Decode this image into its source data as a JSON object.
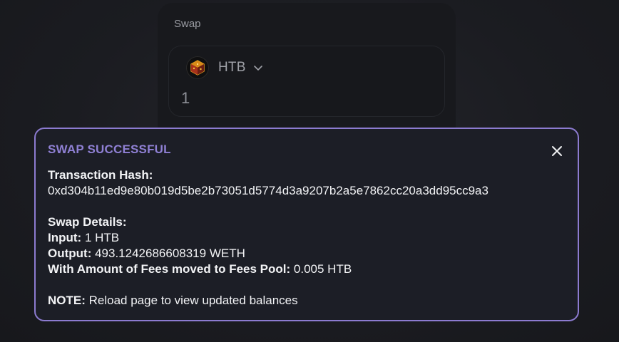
{
  "swap": {
    "title": "Swap",
    "token_symbol": "HTB",
    "amount": "1",
    "token_icon": "htb-cube-logo-icon",
    "chevron_icon": "chevron-down-icon"
  },
  "toast": {
    "title": "SWAP SUCCESSFUL",
    "close_icon": "close-icon",
    "tx_hash_label": "Transaction Hash:",
    "tx_hash_value": "0xd304b11ed9e80b019d5be2b73051d5774d3a9207b2a5e7862cc20a3dd95cc9a3",
    "details_label": "Swap Details:",
    "input_label": "Input:",
    "input_value": "1 HTB",
    "output_label": "Output:",
    "output_value": "493.1242686608319 WETH",
    "fees_label": "With Amount of Fees moved to Fees Pool:",
    "fees_value": "0.005 HTB",
    "note_label": "NOTE:",
    "note_value": "Reload page to view updated balances"
  },
  "colors": {
    "toast_border": "#8c7bd0",
    "toast_title": "#8f80d4",
    "background": "#1b1c21"
  }
}
